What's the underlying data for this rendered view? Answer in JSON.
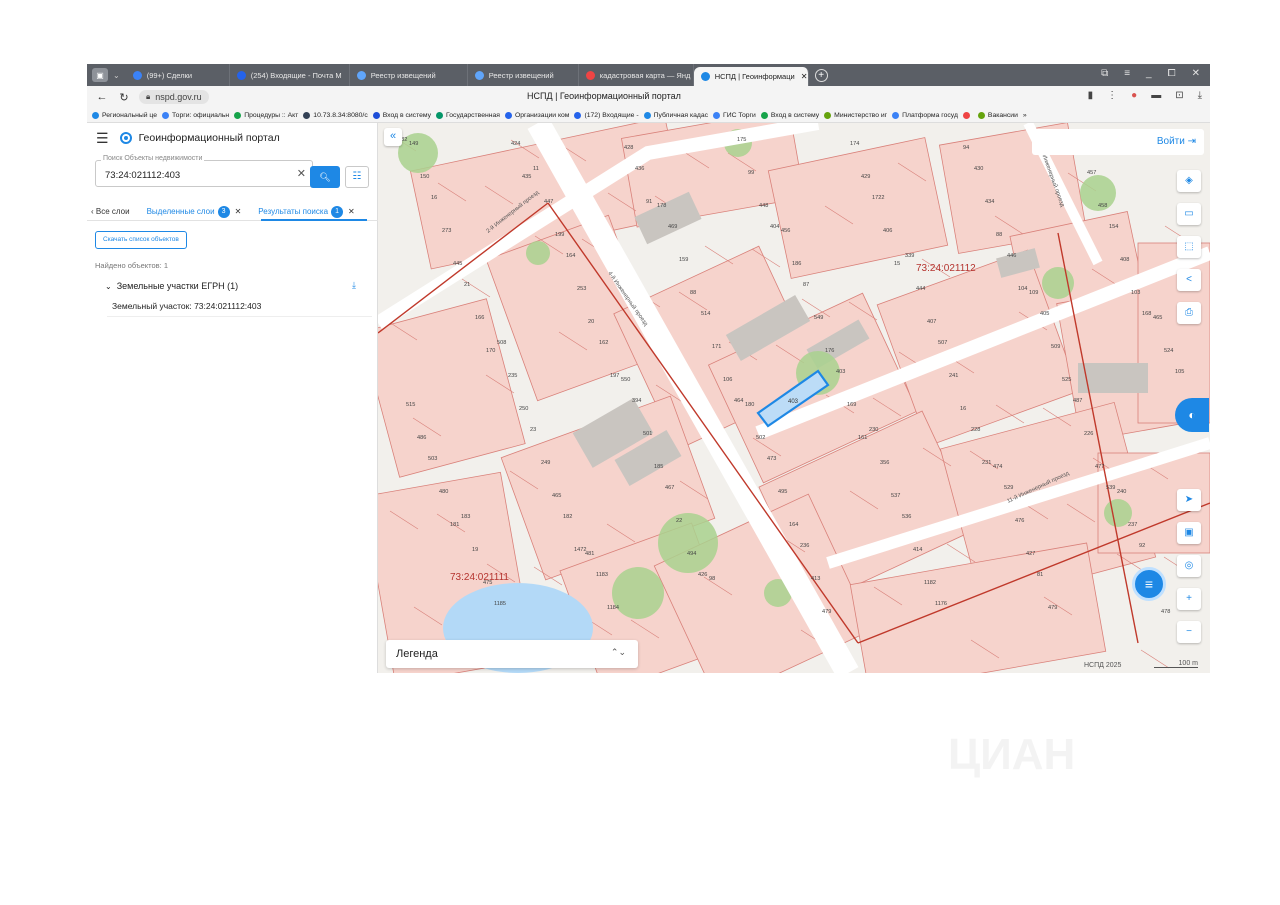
{
  "browser": {
    "tabs": [
      {
        "label": "(99+) Сделки",
        "color": "#3b82f6"
      },
      {
        "label": "(254) Входящие - Почта М",
        "color": "#2563eb"
      },
      {
        "label": "Реестр извещений",
        "color": "#60a5fa"
      },
      {
        "label": "Реестр извещений",
        "color": "#60a5fa"
      },
      {
        "label": "кадастровая карта — Янд",
        "color": "#ef4444"
      },
      {
        "label": "НСПД | Геоинформаци",
        "color": "#1e88e5",
        "active": true
      }
    ],
    "url": "nspd.gov.ru",
    "page_title": "НСПД | Геоинформационный портал",
    "bookmarks": [
      {
        "label": "Региональный це",
        "color": "#1e88e5"
      },
      {
        "label": "Торги: официальн",
        "color": "#3b82f6"
      },
      {
        "label": "Процедуры :: Акт",
        "color": "#16a34a"
      },
      {
        "label": "10.73.8.34:8080/c",
        "color": "#334155"
      },
      {
        "label": "Вход в систему",
        "color": "#1d4ed8"
      },
      {
        "label": "Государственная",
        "color": "#059669"
      },
      {
        "label": "Организации ком",
        "color": "#2563eb"
      },
      {
        "label": "(172) Входящие -",
        "color": "#2563eb"
      },
      {
        "label": "Публичная кадас",
        "color": "#1e88e5"
      },
      {
        "label": "ГИС Торги",
        "color": "#3b82f6"
      },
      {
        "label": "Вход в систему",
        "color": "#16a34a"
      },
      {
        "label": "Министерство иг",
        "color": "#65a30d"
      },
      {
        "label": "Платформа госуд",
        "color": "#3b82f6"
      },
      {
        "label": "",
        "color": "#ef4444"
      },
      {
        "label": "Вакансии",
        "color": "#65a30d"
      }
    ],
    "bookmarks_more": "»"
  },
  "app": {
    "title": "Геоинформационный портал",
    "search": {
      "label": "Поиск Объекты недвижимости",
      "value": "73:24:021112:403"
    },
    "tabs": {
      "all_layers": "Все слои",
      "selected_layers": "Выделенные слои",
      "selected_count": "3",
      "results": "Результаты поиска",
      "results_count": "1"
    },
    "download_list": "Скачать список объектов",
    "found_text": "Найдено объектов: 1",
    "group_label": "Земельные участки ЕГРН (1)",
    "result_item": "Земельный участок: 73:24:021112:403"
  },
  "map": {
    "login": "Войти",
    "legend": "Легенда",
    "attribution": "НСПД 2025",
    "scale": "100 m",
    "quarters": [
      "73:24:021112",
      "73:24:021111"
    ],
    "highlight_label": "403",
    "tools": [
      "layers-icon",
      "ruler-icon",
      "select-area-icon",
      "share-icon",
      "print-icon",
      "locate-icon",
      "screen-icon",
      "pin-icon",
      "zoom-in-icon",
      "zoom-out-icon"
    ],
    "colors": {
      "parcel_fill": "#f6d3cc",
      "parcel_line": "#d9817a",
      "green": "#a9d18e",
      "road": "#ffffff",
      "boundary": "#c0392b",
      "highlight": "#1e88e5",
      "water": "#b3d9f7",
      "building": "#c9c5c0"
    },
    "street_labels": [
      "2-й Инженерный проезд",
      "4-й Инженерный проезд",
      "44-й Инженерный проезд",
      "11-й Инженерный проезд"
    ],
    "parcel_numbers": [
      "432",
      "424",
      "428",
      "175",
      "174",
      "94",
      "151",
      "149",
      "435",
      "436",
      "99",
      "429",
      "430",
      "457",
      "150",
      "11",
      "91",
      "448",
      "1722",
      "434",
      "458",
      "16",
      "447",
      "178",
      "404",
      "406",
      "88",
      "154",
      "273",
      "199",
      "469",
      "456",
      "15",
      "446",
      "408",
      "445",
      "164",
      "159",
      "186",
      "339",
      "104",
      "103",
      "21",
      "253",
      "88",
      "87",
      "444",
      "109",
      "168",
      "166",
      "20",
      "514",
      "549",
      "407",
      "405",
      "465",
      "170",
      "162",
      "171",
      "176",
      "507",
      "509",
      "524",
      "508",
      "197",
      "106",
      "403",
      "241",
      "525",
      "105",
      "235",
      "550",
      "464",
      "169",
      "16",
      "487",
      "515",
      "250",
      "394",
      "180",
      "161",
      "228",
      "226",
      "486",
      "23",
      "501",
      "502",
      "230",
      "231",
      "477",
      "503",
      "249",
      "185",
      "473",
      "356",
      "474",
      "539",
      "480",
      "465",
      "467",
      "495",
      "537",
      "529",
      "240",
      "181",
      "182",
      "22",
      "164",
      "536",
      "476",
      "237",
      "183",
      "1472",
      "494",
      "236",
      "414",
      "427",
      "92",
      "19",
      "481",
      "426",
      "413",
      "1182",
      "81",
      "97",
      "475",
      "1183",
      "98",
      "479",
      "1176",
      "479",
      "478",
      "1185",
      "1184"
    ]
  }
}
